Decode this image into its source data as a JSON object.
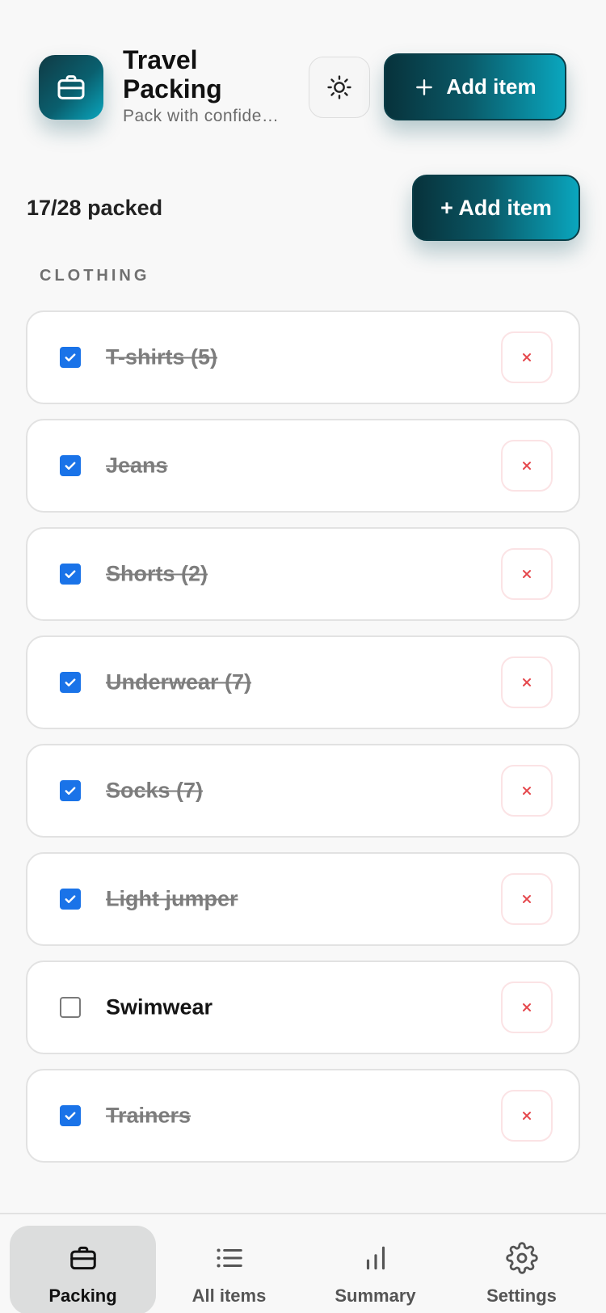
{
  "app": {
    "title": "Travel Packing",
    "subtitle": "Pack with confidence",
    "accent_color": "#0a6e7e",
    "icon": "suitcase-icon"
  },
  "header": {
    "theme_toggle_icon": "sun-icon",
    "add_item_label": "Add item",
    "add_item_icon": "plus-icon"
  },
  "summary": {
    "packed_text": "17/28 packed",
    "add_item_label": "+ Add item"
  },
  "category": {
    "label": "CLOTHING",
    "items": [
      {
        "label": "T-shirts (5)",
        "packed": true
      },
      {
        "label": "Jeans",
        "packed": true
      },
      {
        "label": "Shorts (2)",
        "packed": true
      },
      {
        "label": "Underwear (7)",
        "packed": true
      },
      {
        "label": "Socks (7)",
        "packed": true
      },
      {
        "label": "Light jumper",
        "packed": true
      },
      {
        "label": "Swimwear",
        "packed": false
      },
      {
        "label": "Trainers",
        "packed": true
      }
    ],
    "remove_icon": "close-icon",
    "check_color": "#1a73e8",
    "remove_color": "#e5484d"
  },
  "nav": {
    "items": [
      {
        "label": "Packing",
        "icon": "suitcase-icon",
        "active": true
      },
      {
        "label": "All items",
        "icon": "list-icon",
        "active": false
      },
      {
        "label": "Summary",
        "icon": "bar-chart-icon",
        "active": false
      },
      {
        "label": "Settings",
        "icon": "gear-icon",
        "active": false
      }
    ]
  }
}
